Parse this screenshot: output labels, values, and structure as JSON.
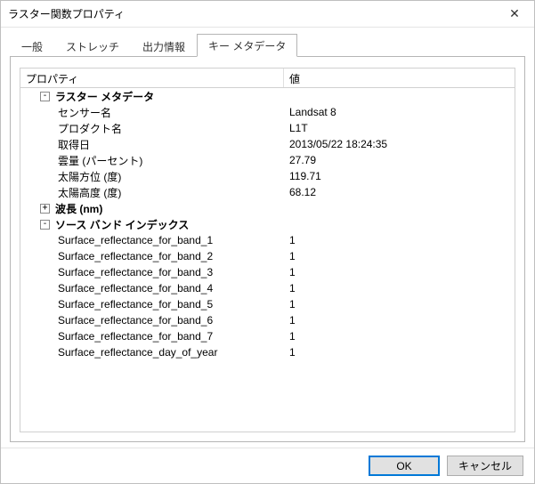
{
  "window": {
    "title": "ラスター関数プロパティ"
  },
  "tabs": {
    "general": "一般",
    "stretch": "ストレッチ",
    "output_info": "出力情報",
    "key_metadata": "キー メタデータ"
  },
  "grid": {
    "columns": {
      "property": "プロパティ",
      "value": "値"
    },
    "groups": {
      "raster_metadata": {
        "label": "ラスター メタデータ",
        "expanded": true,
        "rows": [
          {
            "label": "センサー名",
            "value": "Landsat 8"
          },
          {
            "label": "プロダクト名",
            "value": "L1T"
          },
          {
            "label": "取得日",
            "value": "2013/05/22 18:24:35"
          },
          {
            "label": "雲量 (パーセント)",
            "value": "27.79"
          },
          {
            "label": "太陽方位 (度)",
            "value": "119.71"
          },
          {
            "label": "太陽高度 (度)",
            "value": "68.12"
          }
        ]
      },
      "wavelength": {
        "label": "波長 (nm)",
        "expanded": false,
        "rows": []
      },
      "source_band_index": {
        "label": "ソース バンド インデックス",
        "expanded": true,
        "rows": [
          {
            "label": "Surface_reflectance_for_band_1",
            "value": "1"
          },
          {
            "label": "Surface_reflectance_for_band_2",
            "value": "1"
          },
          {
            "label": "Surface_reflectance_for_band_3",
            "value": "1"
          },
          {
            "label": "Surface_reflectance_for_band_4",
            "value": "1"
          },
          {
            "label": "Surface_reflectance_for_band_5",
            "value": "1"
          },
          {
            "label": "Surface_reflectance_for_band_6",
            "value": "1"
          },
          {
            "label": "Surface_reflectance_for_band_7",
            "value": "1"
          },
          {
            "label": "Surface_reflectance_day_of_year",
            "value": "1"
          }
        ]
      }
    }
  },
  "buttons": {
    "ok": "OK",
    "cancel": "キャンセル"
  },
  "icons": {
    "close": "✕",
    "expanded": "-",
    "collapsed": "+"
  }
}
